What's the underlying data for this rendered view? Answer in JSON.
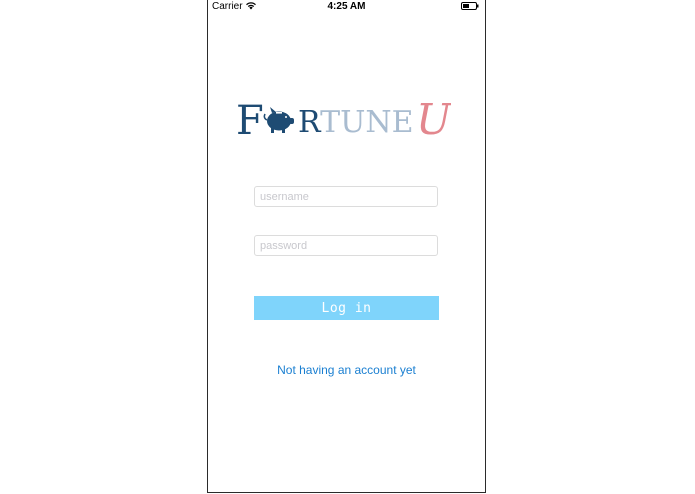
{
  "status_bar": {
    "carrier": "Carrier",
    "time": "4:25 AM"
  },
  "logo": {
    "part1": "F",
    "part2": "RTUNE",
    "part3": "U",
    "colors": {
      "dark": "#1e4b73",
      "light": "#a9bcd0",
      "accent": "#e3878e"
    }
  },
  "form": {
    "username_placeholder": "username",
    "password_placeholder": "password",
    "login_label": "Log in",
    "signup_link": "Not having an account yet"
  },
  "colors": {
    "button": "#7fd4fb",
    "link": "#1a7fd1"
  }
}
